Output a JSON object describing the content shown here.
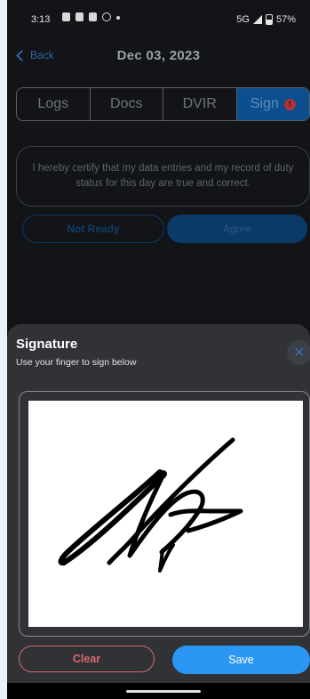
{
  "status_bar": {
    "time": "3:13",
    "network": "5G",
    "battery": "57%"
  },
  "header": {
    "back_label": "Back",
    "title": "Dec 03, 2023"
  },
  "tabs": [
    {
      "label": "Logs",
      "active": false
    },
    {
      "label": "Docs",
      "active": false
    },
    {
      "label": "DVIR",
      "active": false
    },
    {
      "label": "Sign",
      "active": true,
      "badge": "!"
    }
  ],
  "certification": {
    "text": "I hereby certify that my data entries and my record of duty status for this day are true and correct."
  },
  "actions": {
    "not_ready_label": "Not Ready",
    "agree_label": "Agree"
  },
  "signature_sheet": {
    "title": "Signature",
    "subtitle": "Use your finger to sign below",
    "close_icon": "close-icon",
    "clear_label": "Clear",
    "save_label": "Save"
  },
  "colors": {
    "background": "#121417",
    "accent": "#2b96f3",
    "danger": "#cf6a6e",
    "active_tab": "#0b4f8e",
    "sheet": "#303236"
  }
}
